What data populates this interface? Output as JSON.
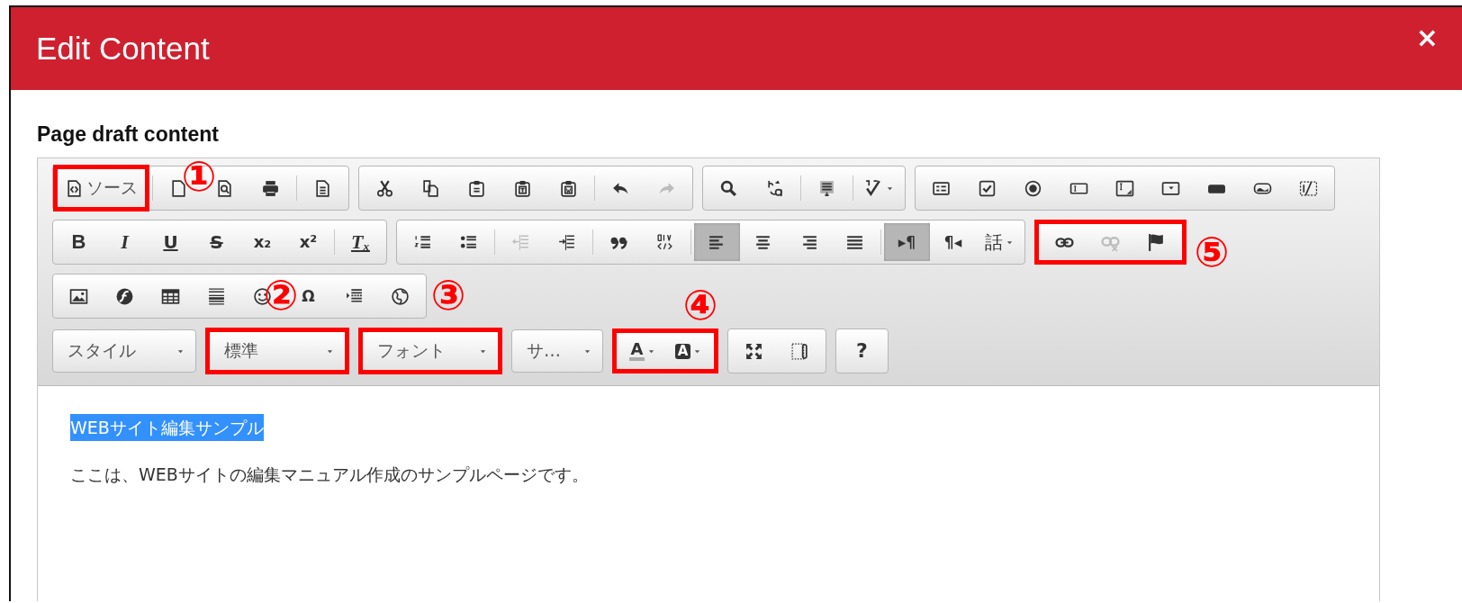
{
  "dialog": {
    "title": "Edit Content",
    "close": "×"
  },
  "field_label": "Page draft content",
  "toolbar": {
    "rows": [
      {
        "groups": [
          {
            "kind": "group",
            "highlighted": false,
            "items": [
              {
                "kind": "text",
                "label": "ソース",
                "active": false,
                "disabled": false,
                "highlighted": true
              },
              {
                "kind": "separator"
              },
              {
                "kind": "icon",
                "active": false,
                "disabled": false,
                "highlighted": false
              },
              {
                "kind": "icon",
                "active": false,
                "disabled": false,
                "highlighted": false
              },
              {
                "kind": "icon",
                "active": false,
                "disabled": false,
                "highlighted": false
              },
              {
                "kind": "separator"
              },
              {
                "kind": "icon",
                "active": false,
                "disabled": false,
                "highlighted": false
              }
            ]
          },
          {
            "kind": "group",
            "highlighted": false,
            "items": [
              {
                "kind": "icon",
                "active": false,
                "disabled": false,
                "highlighted": false
              },
              {
                "kind": "icon",
                "active": false,
                "disabled": false,
                "highlighted": false
              },
              {
                "kind": "icon",
                "active": false,
                "disabled": false,
                "highlighted": false
              },
              {
                "kind": "icon",
                "active": false,
                "disabled": false,
                "highlighted": false
              },
              {
                "kind": "icon",
                "active": false,
                "disabled": false,
                "highlighted": false
              },
              {
                "kind": "separator"
              },
              {
                "kind": "icon",
                "active": false,
                "disabled": false,
                "highlighted": false
              },
              {
                "kind": "icon",
                "active": false,
                "disabled": true,
                "highlighted": false
              }
            ]
          },
          {
            "kind": "group",
            "highlighted": false,
            "items": [
              {
                "kind": "icon",
                "active": false,
                "disabled": false,
                "highlighted": false
              },
              {
                "kind": "icon",
                "active": false,
                "disabled": false,
                "highlighted": false
              },
              {
                "kind": "separator"
              },
              {
                "kind": "icon",
                "active": false,
                "disabled": false,
                "highlighted": false
              },
              {
                "kind": "separator"
              },
              {
                "kind": "icon-menu",
                "active": false,
                "disabled": false,
                "highlighted": false
              }
            ]
          },
          {
            "kind": "group",
            "highlighted": false,
            "items": [
              {
                "kind": "icon",
                "active": false,
                "disabled": false,
                "highlighted": false
              },
              {
                "kind": "icon",
                "active": false,
                "disabled": false,
                "highlighted": false
              },
              {
                "kind": "icon",
                "active": false,
                "disabled": false,
                "highlighted": false
              },
              {
                "kind": "icon",
                "active": false,
                "disabled": false,
                "highlighted": false
              },
              {
                "kind": "icon",
                "active": false,
                "disabled": false,
                "highlighted": false
              },
              {
                "kind": "icon",
                "active": false,
                "disabled": false,
                "highlighted": false
              },
              {
                "kind": "icon",
                "active": false,
                "disabled": false,
                "highlighted": false
              },
              {
                "kind": "icon",
                "active": false,
                "disabled": false,
                "highlighted": false
              },
              {
                "kind": "icon",
                "active": false,
                "disabled": false,
                "highlighted": false
              }
            ]
          }
        ]
      },
      {
        "groups": [
          {
            "kind": "group",
            "highlighted": false,
            "items": [
              {
                "kind": "glyph",
                "glyph": "B",
                "active": false,
                "disabled": false,
                "highlighted": false
              },
              {
                "kind": "glyph",
                "glyph": "I",
                "active": false,
                "disabled": false,
                "highlighted": false
              },
              {
                "kind": "glyph",
                "glyph": "U",
                "active": false,
                "disabled": false,
                "highlighted": false
              },
              {
                "kind": "glyph",
                "glyph": "S",
                "active": false,
                "disabled": false,
                "highlighted": false
              },
              {
                "kind": "glyph",
                "glyph": "x₂",
                "active": false,
                "disabled": false,
                "highlighted": false
              },
              {
                "kind": "glyph",
                "glyph": "x²",
                "active": false,
                "disabled": false,
                "highlighted": false
              },
              {
                "kind": "separator"
              },
              {
                "kind": "glyph",
                "glyph": "Tₓ",
                "active": false,
                "disabled": false,
                "highlighted": false
              }
            ]
          },
          {
            "kind": "group",
            "highlighted": false,
            "items": [
              {
                "kind": "icon",
                "active": false,
                "disabled": false,
                "highlighted": false
              },
              {
                "kind": "icon",
                "active": false,
                "disabled": false,
                "highlighted": false
              },
              {
                "kind": "separator"
              },
              {
                "kind": "icon",
                "active": false,
                "disabled": true,
                "highlighted": false
              },
              {
                "kind": "icon",
                "active": false,
                "disabled": false,
                "highlighted": false
              },
              {
                "kind": "separator"
              },
              {
                "kind": "icon",
                "active": false,
                "disabled": false,
                "highlighted": false
              },
              {
                "kind": "icon",
                "active": false,
                "disabled": false,
                "highlighted": false
              },
              {
                "kind": "separator"
              },
              {
                "kind": "icon",
                "active": true,
                "disabled": false,
                "highlighted": false
              },
              {
                "kind": "icon",
                "active": false,
                "disabled": false,
                "highlighted": false
              },
              {
                "kind": "icon",
                "active": false,
                "disabled": false,
                "highlighted": false
              },
              {
                "kind": "icon",
                "active": false,
                "disabled": false,
                "highlighted": false
              },
              {
                "kind": "separator"
              },
              {
                "kind": "glyph",
                "glyph": "▸¶",
                "active": true,
                "disabled": false,
                "highlighted": false
              },
              {
                "kind": "glyph",
                "glyph": "¶◂",
                "active": false,
                "disabled": false,
                "highlighted": false
              },
              {
                "kind": "glyph-menu",
                "glyph": "話",
                "active": false,
                "disabled": false,
                "highlighted": false
              }
            ]
          },
          {
            "kind": "group",
            "highlighted": true,
            "items": [
              {
                "kind": "icon",
                "active": false,
                "disabled": false,
                "highlighted": false
              },
              {
                "kind": "icon",
                "active": false,
                "disabled": true,
                "highlighted": false
              },
              {
                "kind": "icon",
                "active": false,
                "disabled": false,
                "highlighted": false
              }
            ]
          }
        ]
      },
      {
        "groups": [
          {
            "kind": "group",
            "highlighted": false,
            "items": [
              {
                "kind": "icon",
                "active": false,
                "disabled": false,
                "highlighted": false
              },
              {
                "kind": "icon",
                "active": false,
                "disabled": false,
                "highlighted": false
              },
              {
                "kind": "icon",
                "active": false,
                "disabled": false,
                "highlighted": false
              },
              {
                "kind": "icon",
                "active": false,
                "disabled": false,
                "highlighted": false
              },
              {
                "kind": "icon",
                "active": false,
                "disabled": false,
                "highlighted": false
              },
              {
                "kind": "glyph",
                "glyph": "Ω",
                "active": false,
                "disabled": false,
                "highlighted": false
              },
              {
                "kind": "icon",
                "active": false,
                "disabled": false,
                "highlighted": false
              },
              {
                "kind": "icon",
                "active": false,
                "disabled": false,
                "highlighted": false
              }
            ]
          }
        ]
      },
      {
        "groups": [
          {
            "kind": "combo",
            "label": "スタイル",
            "highlighted": false
          },
          {
            "kind": "combo",
            "label": "標準",
            "highlighted": true
          },
          {
            "kind": "combo",
            "label": "フォント",
            "highlighted": true
          },
          {
            "kind": "combo",
            "label": "サ…",
            "highlighted": false
          },
          {
            "kind": "group",
            "highlighted": true,
            "items": [
              {
                "kind": "text-color",
                "glyph": "A",
                "active": false,
                "disabled": false,
                "highlighted": false
              },
              {
                "kind": "bg-color",
                "glyph": "A",
                "active": false,
                "disabled": false,
                "highlighted": false
              }
            ]
          },
          {
            "kind": "group",
            "highlighted": false,
            "items": [
              {
                "kind": "icon",
                "active": false,
                "disabled": false,
                "highlighted": false
              },
              {
                "kind": "icon",
                "active": false,
                "disabled": false,
                "highlighted": false
              }
            ]
          },
          {
            "kind": "group",
            "highlighted": false,
            "items": [
              {
                "kind": "glyph",
                "glyph": "?",
                "active": false,
                "disabled": false,
                "highlighted": false
              }
            ]
          }
        ]
      }
    ]
  },
  "callouts": [
    {
      "label": "①"
    },
    {
      "label": "②"
    },
    {
      "label": "③"
    },
    {
      "label": "④"
    },
    {
      "label": "⑤"
    }
  ],
  "content": {
    "blocks": [
      {
        "text": "WEBサイト編集サンプル",
        "selected": true
      },
      {
        "text": "ここは、WEBサイトの編集マニュアル作成のサンプルページです。",
        "selected": false
      }
    ]
  }
}
